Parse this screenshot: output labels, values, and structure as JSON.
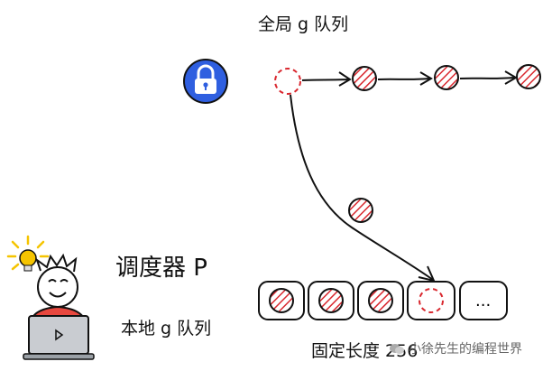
{
  "labels": {
    "global_queue": "全局 g 队列",
    "scheduler": "调度器 P",
    "local_queue": "本地 g 队列",
    "fixed_length": "固定长度 256",
    "ellipsis": "..."
  },
  "watermark": "小徐先生的编程世界",
  "icons": {
    "lock": "lock-icon",
    "lightbulb": "lightbulb-icon",
    "laptop": "laptop-icon",
    "wechat": "wechat-icon"
  },
  "colors": {
    "hatch_red": "#d9272e",
    "lock_blue": "#2f5fe0",
    "bulb_yellow": "#f5c400",
    "person_red": "#e8483f",
    "laptop_gray": "#c9ccd1",
    "stroke": "#111111"
  }
}
